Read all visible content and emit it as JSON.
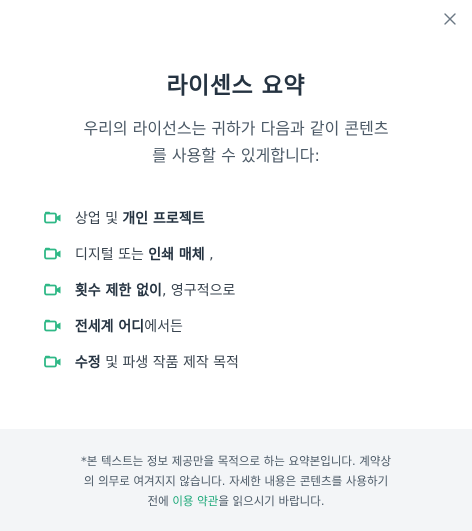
{
  "modal": {
    "title": "라이센스 요약",
    "subtitle_line1": "우리의 라이선스는 귀하가 다음과 같이 콘텐츠",
    "subtitle_line2": "를 사용할 수 있게합니다:",
    "close_icon": "close-icon",
    "icon_color": "#2fb886"
  },
  "features": [
    {
      "icon": "camera-icon",
      "pre": "상업 및 ",
      "bold": "개인 프로젝트",
      "post": ""
    },
    {
      "icon": "camera-icon",
      "pre": "디지털 또는 ",
      "bold": "인쇄 매체",
      "post": " ,"
    },
    {
      "icon": "camera-icon",
      "pre": "",
      "bold": "횟수 제한 없이",
      "post": ", 영구적으로"
    },
    {
      "icon": "camera-icon",
      "pre": "",
      "bold": "전세계 어디",
      "post": "에서든"
    },
    {
      "icon": "camera-icon",
      "pre": "",
      "bold": "수정",
      "post": " 및 파생 작품 제작 목적"
    }
  ],
  "footer": {
    "line1": "*본 텍스트는 정보 제공만을 목적으로 하는 요약본입니다. 계약상",
    "line2": "의 의무로 여겨지지 않습니다. 자세한 내용은 콘텐츠를 사용하기",
    "line3_pre": "전에 ",
    "link": "이용 약관",
    "line3_post": "을 읽으시기 바랍니다.",
    "link_color": "#1fa97a"
  }
}
